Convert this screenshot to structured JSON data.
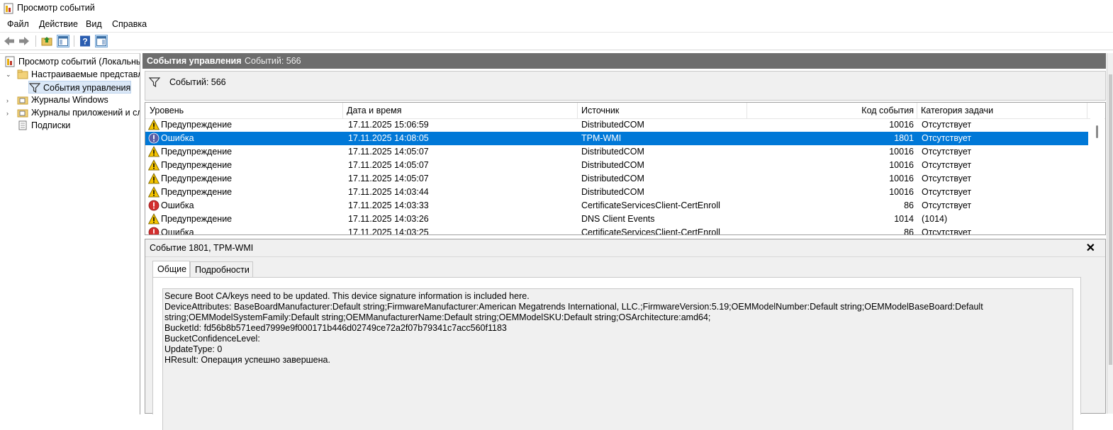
{
  "window": {
    "title": "Просмотр событий"
  },
  "menu": [
    "Файл",
    "Действие",
    "Вид",
    "Справка"
  ],
  "toolbar": {
    "icons": [
      "back-arrow-icon",
      "forward-arrow-icon",
      "up-folder-icon",
      "show-hide-console-tree-icon",
      "help-icon",
      "show-hide-action-pane-icon"
    ]
  },
  "tree": {
    "root": "Просмотр событий (Локальный)",
    "custom_views": "Настраиваемые представления",
    "admin_events": "События управления",
    "windows_logs": "Журналы Windows",
    "app_logs": "Журналы приложений и служб",
    "subscriptions": "Подписки"
  },
  "pane": {
    "title": "События управления",
    "count": "Событий: 566",
    "filter_text": "Событий: 566"
  },
  "columns": {
    "level": "Уровень",
    "datetime": "Дата и время",
    "source": "Источник",
    "event_id": "Код события",
    "category": "Категория задачи"
  },
  "events": [
    {
      "type": "warning",
      "level": "Предупреждение",
      "datetime": "17.11.2025 15:06:59",
      "source": "DistributedCOM",
      "id": "10016",
      "category": "Отсутствует"
    },
    {
      "type": "error-selected",
      "level": "Ошибка",
      "datetime": "17.11.2025 14:08:05",
      "source": "TPM-WMI",
      "id": "1801",
      "category": "Отсутствует"
    },
    {
      "type": "warning",
      "level": "Предупреждение",
      "datetime": "17.11.2025 14:05:07",
      "source": "DistributedCOM",
      "id": "10016",
      "category": "Отсутствует"
    },
    {
      "type": "warning",
      "level": "Предупреждение",
      "datetime": "17.11.2025 14:05:07",
      "source": "DistributedCOM",
      "id": "10016",
      "category": "Отсутствует"
    },
    {
      "type": "warning",
      "level": "Предупреждение",
      "datetime": "17.11.2025 14:05:07",
      "source": "DistributedCOM",
      "id": "10016",
      "category": "Отсутствует"
    },
    {
      "type": "warning",
      "level": "Предупреждение",
      "datetime": "17.11.2025 14:03:44",
      "source": "DistributedCOM",
      "id": "10016",
      "category": "Отсутствует"
    },
    {
      "type": "error",
      "level": "Ошибка",
      "datetime": "17.11.2025 14:03:33",
      "source": "CertificateServicesClient-CertEnroll",
      "id": "86",
      "category": "Отсутствует"
    },
    {
      "type": "warning",
      "level": "Предупреждение",
      "datetime": "17.11.2025 14:03:26",
      "source": "DNS Client Events",
      "id": "1014",
      "category": "(1014)"
    },
    {
      "type": "error",
      "level": "Ошибка",
      "datetime": "17.11.2025 14:03:25",
      "source": "CertificateServicesClient-CertEnroll",
      "id": "86",
      "category": "Отсутствует"
    }
  ],
  "detail": {
    "title": "Событие 1801, TPM-WMI",
    "close": "✕",
    "tabs": [
      "Общие",
      "Подробности"
    ],
    "message": [
      "Secure Boot CA/keys need to be updated. This device signature information is included here.",
      "DeviceAttributes: BaseBoardManufacturer:Default string;FirmwareManufacturer:American Megatrends International, LLC.;FirmwareVersion:5.19;OEMModelNumber:Default string;OEMModelBaseBoard:Default string;OEMModelSystemFamily:Default string;OEMManufacturerName:Default string;OEMModelSKU:Default string;OSArchitecture:amd64;",
      "BucketId: fd56b8b571eed7999e9f000171b446d02749ce72a2f07b79341c7acc560f1183",
      "BucketConfidenceLevel:",
      "UpdateType: 0",
      "HResult: Операция успешно завершена."
    ]
  }
}
